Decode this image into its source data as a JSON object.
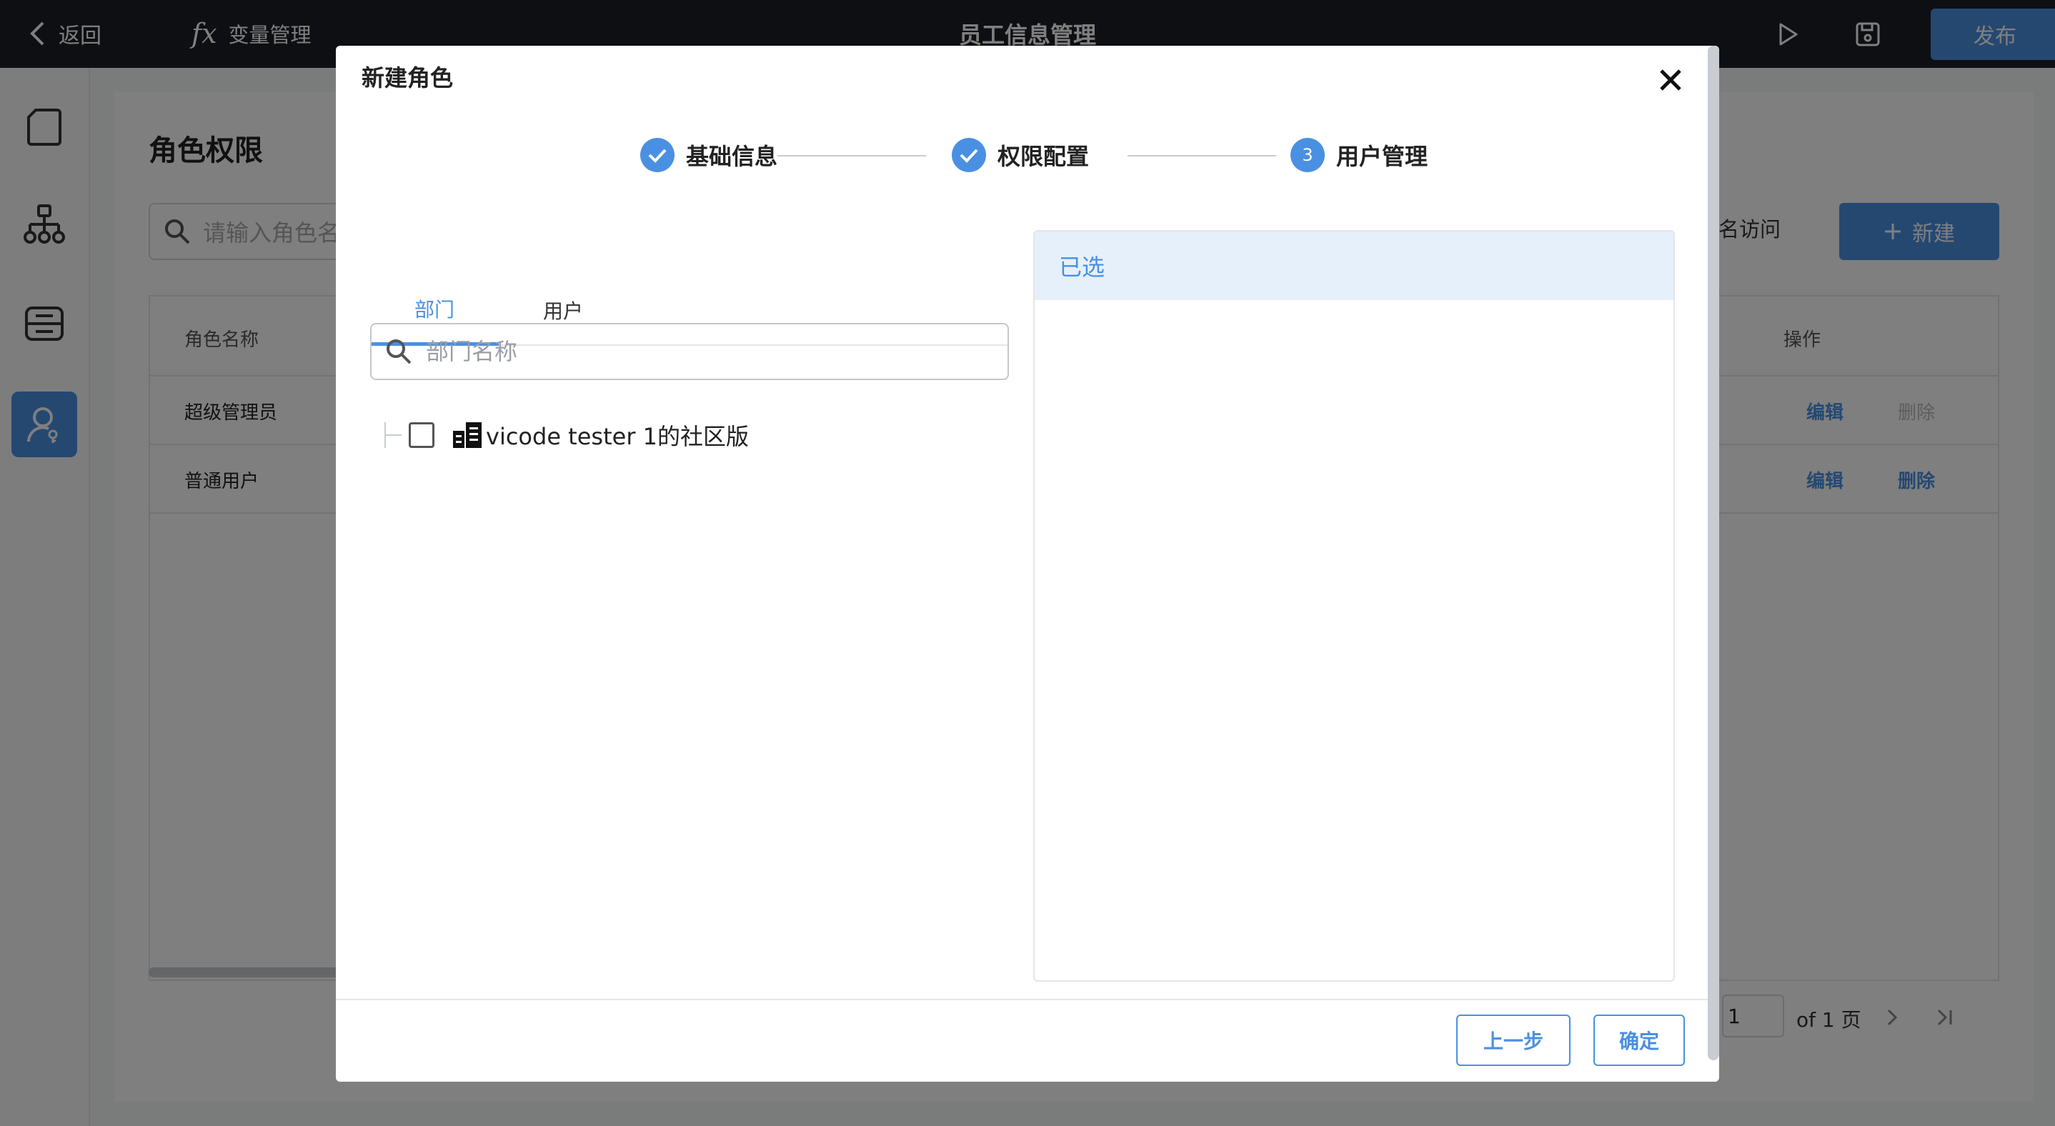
{
  "topbar": {
    "back_label": "返回",
    "fx_symbol": "fx",
    "variables_label": "变量管理",
    "app_title": "员工信息管理",
    "publish_label": "发布"
  },
  "main": {
    "page_title": "角色权限",
    "search_placeholder": "请输入角色名",
    "anonymous_access": "名访问",
    "new_label": "新建",
    "table": {
      "col_role": "角色名称",
      "col_actions": "操作",
      "rows": [
        {
          "name": "超级管理员",
          "edit": "编辑",
          "delete": "删除"
        },
        {
          "name": "普通用户",
          "edit": "编辑",
          "delete": "删除"
        }
      ]
    },
    "pager": {
      "page_value": "1",
      "total": "of 1 页"
    }
  },
  "modal": {
    "title": "新建角色",
    "steps": [
      {
        "label": "基础信息",
        "state": "done"
      },
      {
        "label": "权限配置",
        "state": "done"
      },
      {
        "label": "用户管理",
        "state": "current",
        "number": "3"
      }
    ],
    "tabs": [
      {
        "label": "部门",
        "active": true
      },
      {
        "label": "用户",
        "active": false
      }
    ],
    "dept_search_placeholder": "部门名称",
    "tree": [
      {
        "label": "vicode tester 1的社区版",
        "checked": false,
        "icon": "building-icon"
      }
    ],
    "selected_header": "已选",
    "prev_label": "上一步",
    "confirm_label": "确定"
  },
  "colors": {
    "accent": "#4a90e2",
    "topbar_bg": "#1c1f24",
    "selected_header_bg": "#e6f0fb"
  }
}
